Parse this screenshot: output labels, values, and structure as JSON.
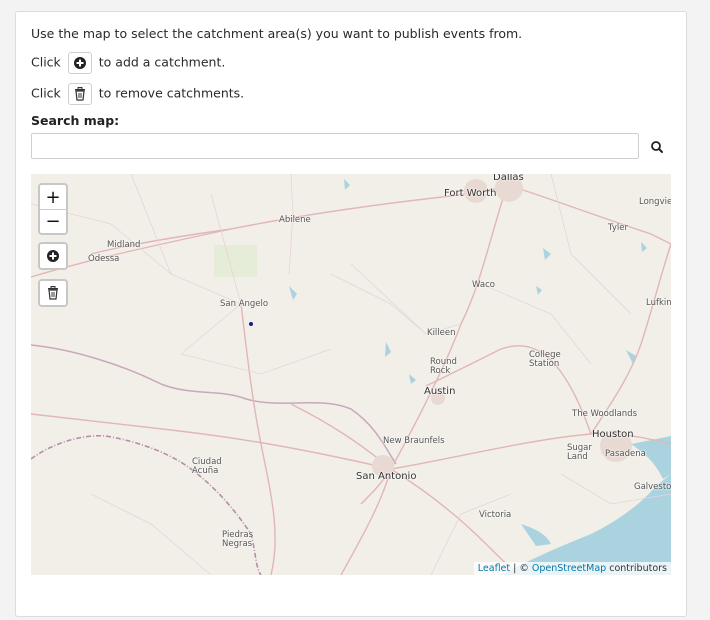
{
  "instructions": {
    "line1": "Use the map to select the catchment area(s) you want to publish events from.",
    "line2_prefix": "Click",
    "line2_suffix": "to add a catchment.",
    "line3_prefix": "Click",
    "line3_suffix": "to remove catchments."
  },
  "search": {
    "label": "Search map:",
    "value": "",
    "placeholder": ""
  },
  "map": {
    "zoom_in": "+",
    "zoom_out": "−",
    "attribution": {
      "leaflet": "Leaflet",
      "separator": " | © ",
      "osm": "OpenStreetMap",
      "suffix": " contributors"
    },
    "cities": [
      {
        "name": "Dallas"
      },
      {
        "name": "Fort Worth"
      },
      {
        "name": "Abilene"
      },
      {
        "name": "Midland"
      },
      {
        "name": "Odessa"
      },
      {
        "name": "Longview"
      },
      {
        "name": "Tyler"
      },
      {
        "name": "San Angelo"
      },
      {
        "name": "Waco"
      },
      {
        "name": "Lufkin"
      },
      {
        "name": "Killeen"
      },
      {
        "name": "Round Rock"
      },
      {
        "name": "College Station"
      },
      {
        "name": "Austin"
      },
      {
        "name": "The Woodlands"
      },
      {
        "name": "Houston"
      },
      {
        "name": "Sugar Land"
      },
      {
        "name": "Pasadena"
      },
      {
        "name": "New Braunfels"
      },
      {
        "name": "Ciudad Acuña"
      },
      {
        "name": "San Antonio"
      },
      {
        "name": "Galveston"
      },
      {
        "name": "Victoria"
      },
      {
        "name": "Piedras Negras"
      }
    ]
  },
  "colors": {
    "map_land": "#f2efe9",
    "water": "#aad3df",
    "road": "#e8c2c2",
    "border": "#b58da6",
    "link": "#0078a8"
  }
}
